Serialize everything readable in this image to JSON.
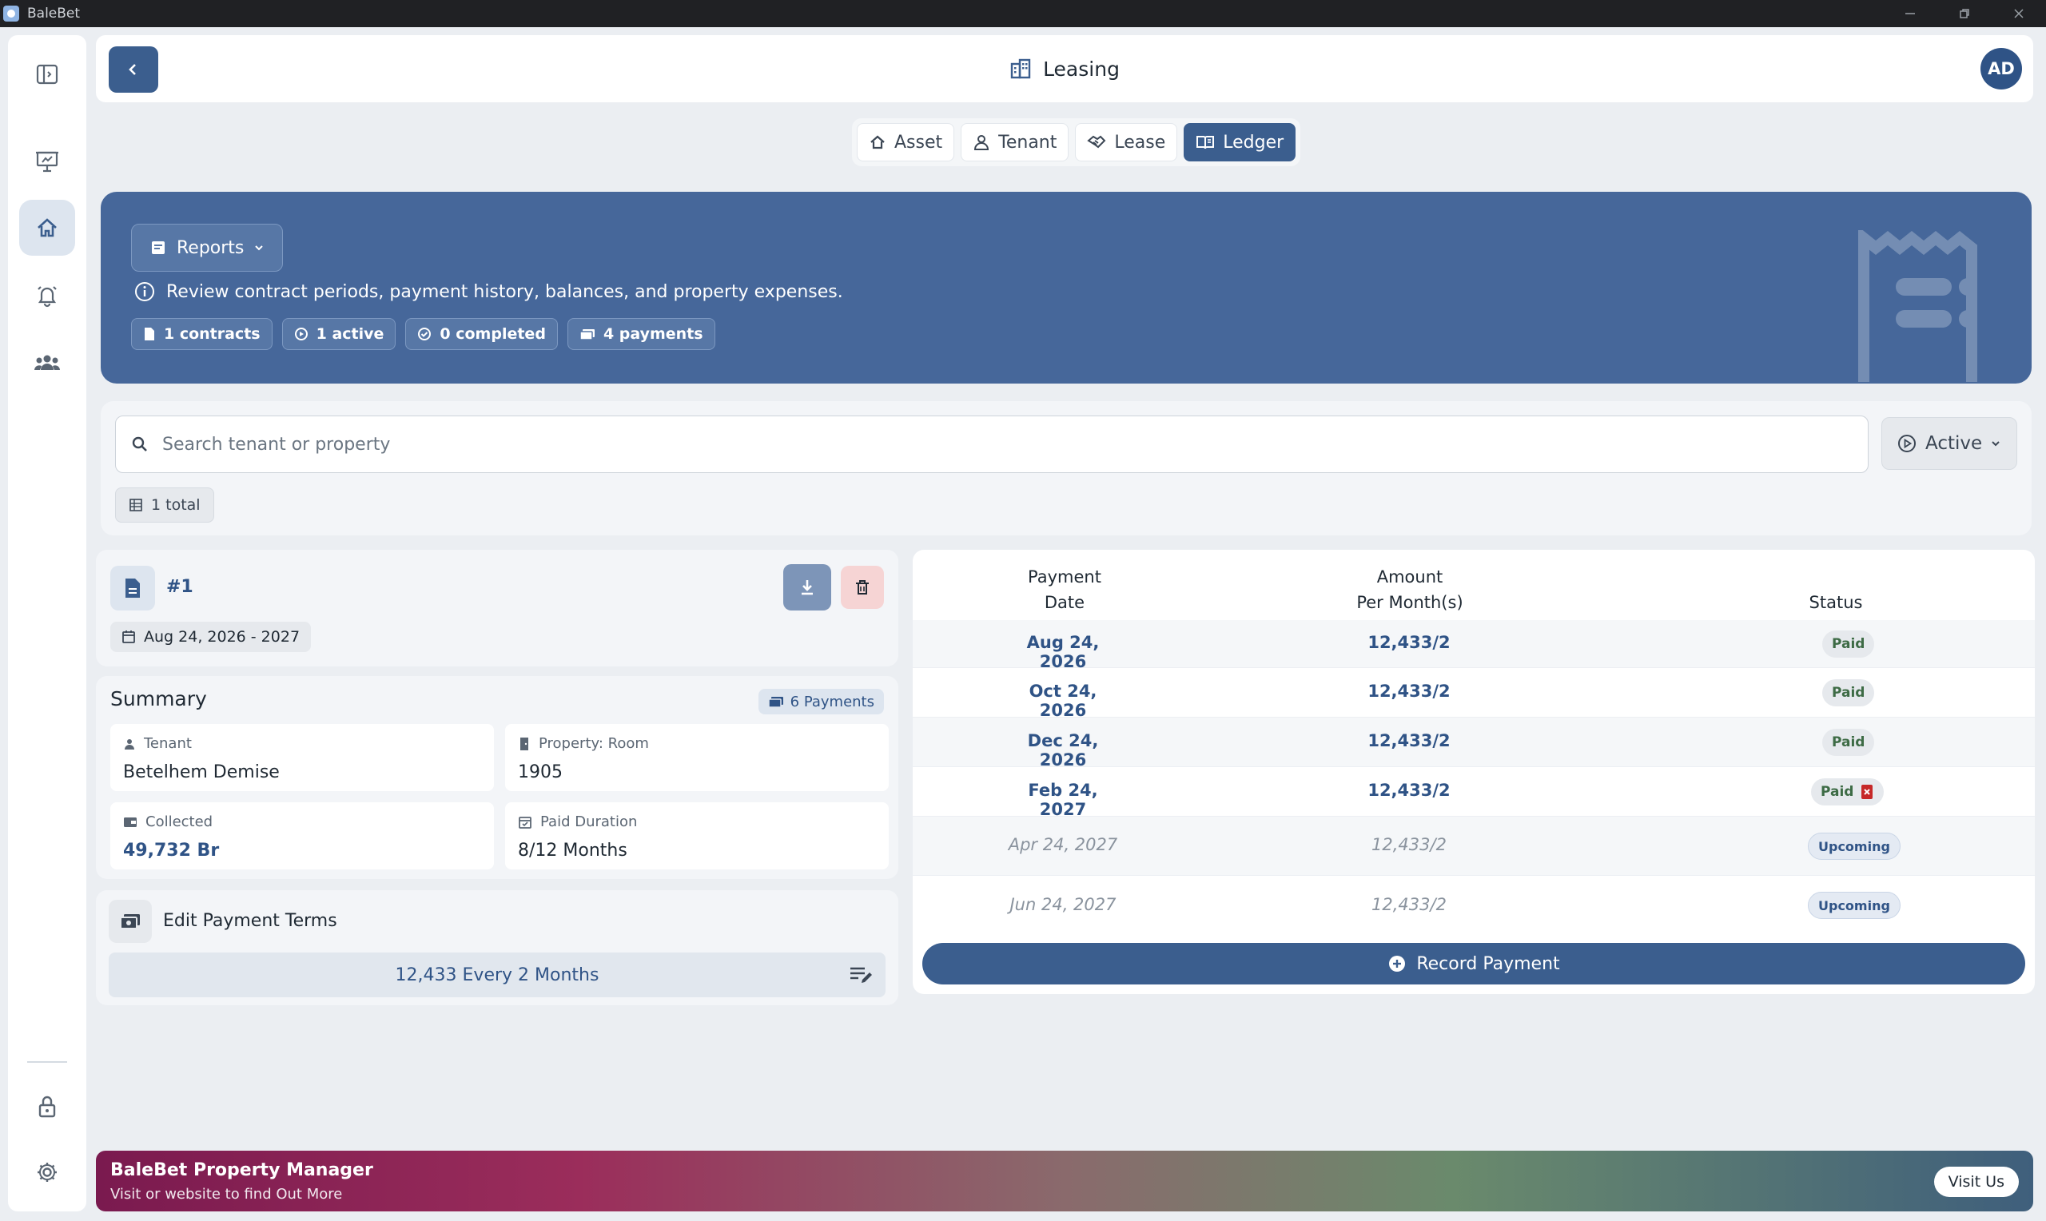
{
  "window": {
    "title": "BaleBet"
  },
  "header": {
    "title": "Leasing",
    "avatar_initials": "AD"
  },
  "tabs": [
    {
      "label": "Asset",
      "icon": "home-icon",
      "active": false
    },
    {
      "label": "Tenant",
      "icon": "person-icon",
      "active": false
    },
    {
      "label": "Lease",
      "icon": "handshake-icon",
      "active": false
    },
    {
      "label": "Ledger",
      "icon": "book-icon",
      "active": true
    }
  ],
  "banner": {
    "reports_label": "Reports",
    "info": "Review contract periods, payment history, balances, and property expenses.",
    "chips": [
      "1 contracts",
      "1 active",
      "0 completed",
      "4 payments"
    ]
  },
  "search": {
    "placeholder": "Search tenant or property",
    "status_filter": "Active",
    "total": "1 total"
  },
  "contract": {
    "id": "#1",
    "period": "Aug 24, 2026 - 2027"
  },
  "summary": {
    "title": "Summary",
    "payments_badge": "6 Payments",
    "tenant_label": "Tenant",
    "tenant_value": "Betelhem Demise",
    "property_label": "Property: Room",
    "property_value": "1905",
    "collected_label": "Collected",
    "collected_value": "49,732 Br",
    "duration_label": "Paid Duration",
    "duration_value": "8/12 Months"
  },
  "terms": {
    "title": "Edit Payment Terms",
    "value": "12,433 Every 2 Months"
  },
  "ledger": {
    "col_date_1": "Payment",
    "col_date_2": "Date",
    "col_amount_1": "Amount",
    "col_amount_2": "Per Month(s)",
    "col_status": "Status",
    "rows": [
      {
        "date": "Aug 24, 2026",
        "amount": "12,433/2",
        "status": "Paid"
      },
      {
        "date": "Oct 24, 2026",
        "amount": "12,433/2",
        "status": "Paid"
      },
      {
        "date": "Dec 24, 2026",
        "amount": "12,433/2",
        "status": "Paid"
      },
      {
        "date": "Feb 24, 2027",
        "amount": "12,433/2",
        "status": "Paid"
      },
      {
        "date": "Apr 24, 2027",
        "amount": "12,433/2",
        "status": "Upcoming"
      },
      {
        "date": "Jun 24, 2027",
        "amount": "12,433/2",
        "status": "Upcoming"
      }
    ],
    "record_label": "Record Payment"
  },
  "footer": {
    "title": "BaleBet Property Manager",
    "subtitle": "Visit or website to find Out More",
    "visit_label": "Visit Us"
  },
  "colors": {
    "primary": "#3b5e8e",
    "banner": "#46679a",
    "paid_text": "#3d6b45",
    "delete_red": "#c62828"
  }
}
